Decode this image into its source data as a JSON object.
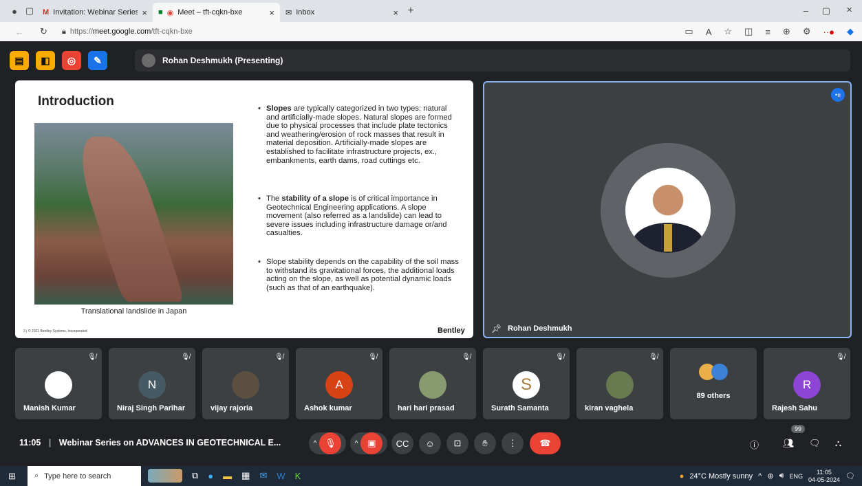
{
  "browser": {
    "tabs": [
      {
        "title": "Invitation: Webinar Series on ADV",
        "icon": "gmail-icon"
      },
      {
        "title": "Meet – tft-cqkn-bxe",
        "icon": "meet-icon",
        "active": true
      },
      {
        "title": "Inbox",
        "icon": "mail-icon"
      }
    ],
    "url_prefix": "https://",
    "url_host": "meet.google.com",
    "url_path": "/tft-cqkn-bxe"
  },
  "meet": {
    "presenter_bar": "Rohan Deshmukh (Presenting)",
    "slide": {
      "title": "Introduction",
      "caption": "Translational landslide in Japan",
      "footer": "3  |  © 2021 Bentley Systems, Incorporated",
      "brand": "Bentley",
      "bullets": [
        {
          "bold": "Slopes",
          "text": " are typically categorized in two types: natural and artificially-made slopes. Natural slopes are formed due to physical processes that include plate tectonics and weathering/erosion of rock masses that result in material deposition. Artificially-made slopes are established to facilitate infrastructure projects, ex., embankments, earth dams, road cuttings etc."
        },
        {
          "pre": "The ",
          "bold": "stability of a slope",
          "text": " is of critical importance in Geotechnical Engineering applications. A slope movement (also referred as a landslide) can lead to severe issues including infrastructure damage or/and casualties."
        },
        {
          "text": "Slope stability depends on the capability of the soil mass to withstand its gravitational forces, the additional loads acting on the slope, as well as potential dynamic loads (such as that of an earthquake)."
        }
      ]
    },
    "speaker_name": "Rohan Deshmukh",
    "participants": [
      {
        "name": "Manish Kumar",
        "initial": "",
        "color": "#ffffff"
      },
      {
        "name": "Niraj Singh Parihar",
        "initial": "N",
        "color": "#455a64"
      },
      {
        "name": "vijay rajoria",
        "initial": "",
        "color": "#5b5040"
      },
      {
        "name": "Ashok kumar",
        "initial": "A",
        "color": "#d84315"
      },
      {
        "name": "hari hari prasad",
        "initial": "",
        "color": "#8a9a70"
      },
      {
        "name": "Surath Samanta",
        "initial": "S",
        "color": "#ffffff"
      },
      {
        "name": "kiran vaghela",
        "initial": "",
        "color": "#6a7a50"
      },
      {
        "name": "",
        "initial": "",
        "color": "#3c4043",
        "others": "89 others"
      },
      {
        "name": "Rajesh Sahu",
        "initial": "R",
        "color": "#8e44d4"
      }
    ],
    "time": "11:05",
    "meeting_title": "Webinar Series on ADVANCES IN GEOTECHNICAL E...",
    "participant_count": "99"
  },
  "taskbar": {
    "search_placeholder": "Type here to search",
    "weather": "24°C  Mostly sunny",
    "lang": "ENG",
    "time": "11:05",
    "date": "04-05-2024"
  }
}
